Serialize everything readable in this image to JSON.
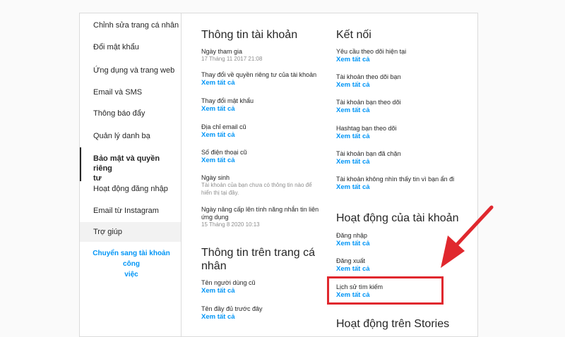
{
  "sidebar": {
    "items": [
      {
        "label": "Chỉnh sửa trang cá nhân"
      },
      {
        "label": "Đổi mật khẩu"
      },
      {
        "label": "Ứng dụng và trang web"
      },
      {
        "label": "Email và SMS"
      },
      {
        "label": "Thông báo đẩy"
      },
      {
        "label": "Quản lý danh bạ"
      },
      {
        "label": "Bảo mật và quyền riêng tư",
        "line1": "Bảo mật và quyền riêng",
        "line2": "tư"
      },
      {
        "label": "Hoạt động đăng nhập"
      },
      {
        "label": "Email từ Instagram"
      },
      {
        "label": "Trợ giúp"
      }
    ],
    "switch_link_line1": "Chuyển sang tài khoản công",
    "switch_link_line2": "việc"
  },
  "account_info": {
    "title": "Thông tin tài khoản",
    "date_joined_label": "Ngày tham gia",
    "date_joined_value": "17 Tháng 11 2017 21:08",
    "privacy_changes_label": "Thay đổi về quyền riêng tư của tài khoản",
    "privacy_changes_link": "Xem tất cả",
    "password_changes_label": "Thay đổi mật khẩu",
    "password_changes_link": "Xem tất cả",
    "former_email_label": "Địa chỉ email cũ",
    "former_email_link": "Xem tất cả",
    "former_phone_label": "Số điện thoại cũ",
    "former_phone_link": "Xem tất cả",
    "birthday_label": "Ngày sinh",
    "birthday_note_line1": "Tài khoản của bạn chưa có thông tin nào để",
    "birthday_note_line2": "hiển thị tại đây.",
    "stories_upgrade_label_line1": "Ngày nâng cấp lên tính năng nhắn tin liên",
    "stories_upgrade_label_line2": "ứng dụng",
    "stories_upgrade_value": "15 Tháng 8 2020 10:13"
  },
  "profile_info": {
    "title_line1": "Thông tin trên trang cá",
    "title_line2": "nhân",
    "former_usernames_label": "Tên người dùng cũ",
    "former_usernames_link": "Xem tất cả",
    "former_fullnames_label": "Tên đầy đủ trước đây",
    "former_fullnames_link": "Xem tất cả"
  },
  "connections": {
    "title": "Kết nối",
    "items": [
      {
        "label": "Yêu cầu theo dõi hiện tại",
        "link": "Xem tất cả"
      },
      {
        "label": "Tài khoản theo dõi bạn",
        "link": "Xem tất cả"
      },
      {
        "label": "Tài khoản bạn theo dõi",
        "link": "Xem tất cả"
      },
      {
        "label": "Hashtag bạn theo dõi",
        "link": "Xem tất cả"
      },
      {
        "label": "Tài khoản bạn đã chặn",
        "link": "Xem tất cả"
      },
      {
        "label": "Tài khoản không nhìn thấy tin vì bạn ẩn đi",
        "link": "Xem tất cả"
      }
    ]
  },
  "account_activity": {
    "title": "Hoạt động của tài khoản",
    "items": [
      {
        "label": "Đăng nhập",
        "link": "Xem tất cả"
      },
      {
        "label": "Đăng xuất",
        "link": "Xem tất cả"
      },
      {
        "label": "Lịch sử tìm kiếm",
        "link": "Xem tất cả"
      }
    ],
    "next_section_partial": "Hoạt động trên Stories"
  },
  "annotation": {
    "color": "#e0282e"
  }
}
